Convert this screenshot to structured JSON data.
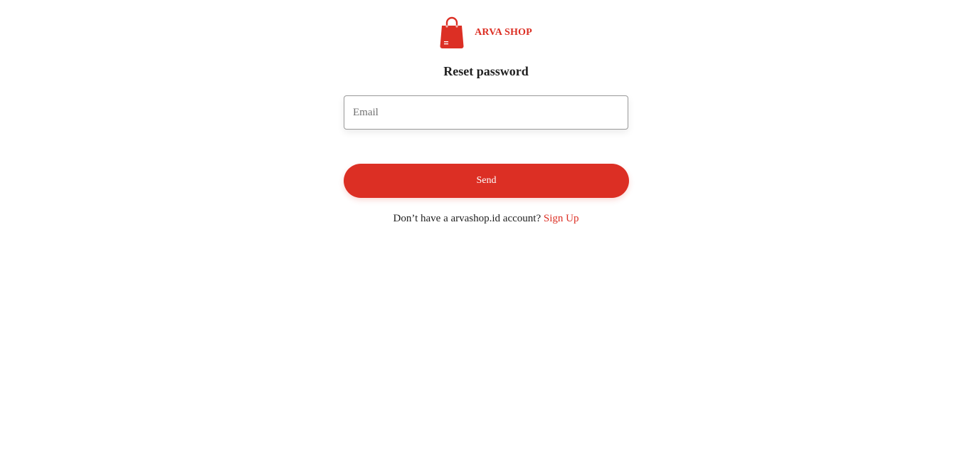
{
  "brand": {
    "name": "ARVA SHOP",
    "accent_color": "#dc2f24",
    "logo_icon": "shopping-bag-icon"
  },
  "page": {
    "title": "Reset password"
  },
  "form": {
    "email_placeholder": "Email",
    "email_value": "",
    "send_label": "Send"
  },
  "footer": {
    "prompt": "Don’t have a arvashop.id account?",
    "signup_label": "Sign Up"
  }
}
